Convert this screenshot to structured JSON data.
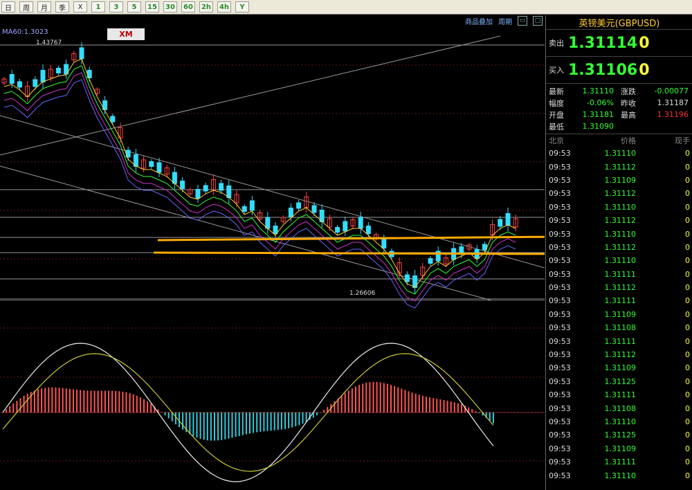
{
  "toolbar": {
    "buttons": [
      {
        "label": "日",
        "name": "period-day-button"
      },
      {
        "label": "周",
        "name": "period-week-button"
      },
      {
        "label": "月",
        "name": "period-month-button"
      },
      {
        "label": "季",
        "name": "period-quarter-button"
      },
      {
        "label": "X",
        "name": "period-x-button"
      },
      {
        "label": "1",
        "name": "period-1min-button"
      },
      {
        "label": "3",
        "name": "period-3min-button"
      },
      {
        "label": "5",
        "name": "period-5min-button"
      },
      {
        "label": "15",
        "name": "period-15min-button"
      },
      {
        "label": "30",
        "name": "period-30min-button"
      },
      {
        "label": "60",
        "name": "period-60min-button"
      },
      {
        "label": "2h",
        "name": "period-2h-button"
      },
      {
        "label": "4h",
        "name": "period-4h-button"
      },
      {
        "label": "Y",
        "name": "period-year-button"
      }
    ]
  },
  "chart_toolbar": {
    "overlay": "商品叠加",
    "period": "周期"
  },
  "chart": {
    "ma_label": "MA60:1.3023",
    "logo": "XM",
    "high_label": "1.43767",
    "low_label": "1.26606"
  },
  "panel": {
    "title": "英镑美元(GBPUSD)",
    "sell_label": "卖出",
    "sell_price": "1.31114",
    "sell_tail": "0",
    "buy_label": "买入",
    "buy_price": "1.31106",
    "buy_tail": "0",
    "stats": [
      {
        "k1": "最新",
        "v1": "1.31110",
        "k2": "涨跌",
        "v2": "-0.00077",
        "c2": "#33ff33"
      },
      {
        "k1": "幅度",
        "v1": "-0.06%",
        "k2": "昨收",
        "v2": "1.31187",
        "c2": "#dddddd"
      },
      {
        "k1": "开盘",
        "v1": "1.31181",
        "k2": "最高",
        "v2": "1.31196",
        "c2": "#ff3333"
      },
      {
        "k1": "最低",
        "v1": "1.31090",
        "k2": "",
        "v2": "",
        "c2": "#dddddd"
      }
    ],
    "tick_headers": {
      "time": "北京",
      "price": "价格",
      "vol": "现手"
    },
    "ticks": [
      {
        "t": "09:53",
        "p": "1.31110",
        "v": "0"
      },
      {
        "t": "09:53",
        "p": "1.31112",
        "v": "0"
      },
      {
        "t": "09:53",
        "p": "1.31109",
        "v": "0"
      },
      {
        "t": "09:53",
        "p": "1.31112",
        "v": "0"
      },
      {
        "t": "09:53",
        "p": "1.31110",
        "v": "0"
      },
      {
        "t": "09:53",
        "p": "1.31112",
        "v": "0"
      },
      {
        "t": "09:53",
        "p": "1.31110",
        "v": "0"
      },
      {
        "t": "09:53",
        "p": "1.31112",
        "v": "0"
      },
      {
        "t": "09:53",
        "p": "1.31110",
        "v": "0"
      },
      {
        "t": "09:53",
        "p": "1.31111",
        "v": "0"
      },
      {
        "t": "09:53",
        "p": "1.31112",
        "v": "0"
      },
      {
        "t": "09:53",
        "p": "1.31111",
        "v": "0"
      },
      {
        "t": "09:53",
        "p": "1.31109",
        "v": "0"
      },
      {
        "t": "09:53",
        "p": "1.31108",
        "v": "0"
      },
      {
        "t": "09:53",
        "p": "1.31111",
        "v": "0"
      },
      {
        "t": "09:53",
        "p": "1.31112",
        "v": "0"
      },
      {
        "t": "09:53",
        "p": "1.31109",
        "v": "0"
      },
      {
        "t": "09:53",
        "p": "1.31125",
        "v": "0"
      },
      {
        "t": "09:53",
        "p": "1.31111",
        "v": "0"
      },
      {
        "t": "09:53",
        "p": "1.31108",
        "v": "0"
      },
      {
        "t": "09:53",
        "p": "1.31110",
        "v": "0"
      },
      {
        "t": "09:53",
        "p": "1.31125",
        "v": "0"
      },
      {
        "t": "09:53",
        "p": "1.31109",
        "v": "0"
      },
      {
        "t": "09:53",
        "p": "1.31111",
        "v": "0"
      },
      {
        "t": "09:53",
        "p": "1.31110",
        "v": "0"
      }
    ]
  },
  "colors": {
    "up": "#33ff33",
    "down": "#ff3333",
    "accent": "#ffcc33",
    "candle": "#33ddff"
  }
}
